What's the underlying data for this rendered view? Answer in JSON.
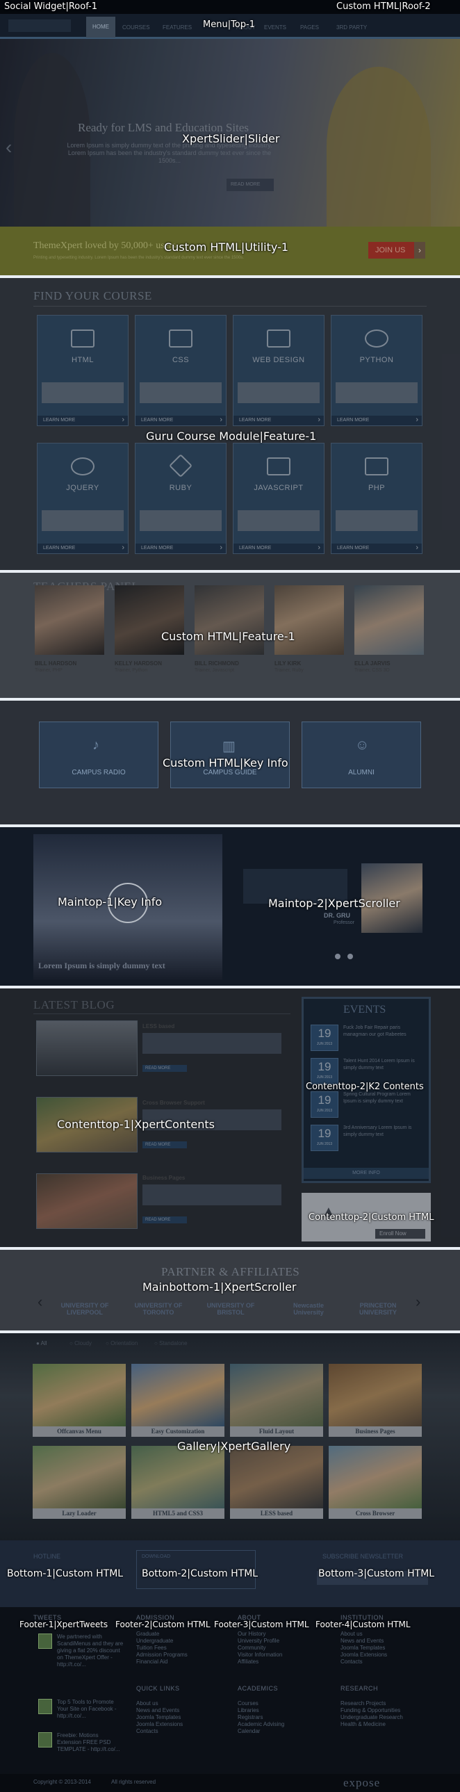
{
  "overlay_labels": {
    "roof1": "Social Widget|Roof-1",
    "roof2": "Custom HTML|Roof-2",
    "top1": "Menu|Top-1",
    "slider": "XpertSlider|Slider",
    "utility1": "Custom HTML|Utility-1",
    "feature1_course": "Guru Course Module|Feature-1",
    "feature1_teachers": "Custom HTML|Feature-1",
    "keyinfo": "Custom HTML|Key Info",
    "maintop1": "Maintop-1|Key Info",
    "maintop2": "Maintop-2|XpertScroller",
    "contenttop2_k2": "Contenttop-2|K2 Contents",
    "contenttop1": "Contenttop-1|XpertContents",
    "contenttop2_html": "Contenttop-2|Custom HTML",
    "mainbottom1": "Mainbottom-1|XpertScroller",
    "gallery": "Gallery|XpertGallery",
    "bottom1": "Bottom-1|Custom HTML",
    "bottom2": "Bottom-2|Custom HTML",
    "bottom3": "Bottom-3|Custom HTML",
    "footer1": "Footer-1|XpertTweets",
    "footer2": "Footer-2|Custom HTML",
    "footer3": "Footer-3|Custom HTML",
    "footer4": "Footer-4|Custom HTML"
  },
  "menu": {
    "items": [
      "HOME",
      "COURSES",
      "FEATURES",
      "ABOUT",
      "EVENTS",
      "PAGES",
      "3RD PARTY"
    ]
  },
  "slider": {
    "title": "Ready for LMS and Education Sites",
    "text": "Lorem Ipsum is simply dummy text of the printing and typesetting industry. Lorem Ipsum has been the industry's standard dummy text ever since the 1500s...",
    "button": "READ MORE"
  },
  "utility": {
    "text": "ThemeXpert loved by 50,000+ users",
    "sub": "Printing and typesetting industry. Lorem Ipsum has been the industry's standard dummy text ever since the 1500s.",
    "button": "JOIN US"
  },
  "course": {
    "heading": "FIND YOUR COURSE",
    "cards": [
      "HTML",
      "CSS",
      "WEB DESIGN",
      "PYTHON",
      "JQUERY",
      "RUBY",
      "JAVASCRIPT",
      "PHP"
    ],
    "button": "LEARN MORE"
  },
  "teachers": {
    "heading": "TEACHERS PANEL",
    "items": [
      {
        "name": "BILL HARDSON",
        "role": "Trainer, PHP"
      },
      {
        "name": "KELLY HARDSON",
        "role": "Trainer, Python"
      },
      {
        "name": "BILL RICHMOND",
        "role": "Trainer, Javascript"
      },
      {
        "name": "LILY KIRK",
        "role": "Trainer, Ruby"
      },
      {
        "name": "ELLA JARVIS",
        "role": "Trainer, CSS 3D"
      }
    ]
  },
  "keyinfo": {
    "items": [
      "CAMPUS RADIO",
      "CAMPUS GUIDE",
      "ALUMNI"
    ]
  },
  "maintop": {
    "caption": "Lorem Ipsum is simply dummy text",
    "person": "DR. GRU",
    "person_role": "Professor"
  },
  "blog": {
    "heading": "LATEST BLOG",
    "items": [
      {
        "title": "LESS based",
        "button": "READ MORE"
      },
      {
        "title": "Cross Browser Support",
        "button": "READ MORE"
      },
      {
        "title": "Business Pages",
        "button": "READ MORE"
      }
    ]
  },
  "events": {
    "heading": "EVENTS",
    "items": [
      {
        "day": "19",
        "month": "JUN 2013",
        "text": "Fuck Job Fair Repair paris managman our got Rabeetes"
      },
      {
        "day": "19",
        "month": "JUN 2013",
        "text": "Talent Hunt 2014 Lorem Ipsum is simply dummy text"
      },
      {
        "day": "19",
        "month": "JUN 2013",
        "text": "Spring Cultural Program Lorem Ipsum is simply dummy text"
      },
      {
        "day": "19",
        "month": "JUN 2013",
        "text": "3rd Anniversary Lorem Ipsum is simply dummy text"
      }
    ],
    "more": "MORE INFO",
    "enroll": "Enroll Now"
  },
  "partners": {
    "heading": "PARTNER & AFFILIATES",
    "logos": [
      "UNIVERSITY OF LIVERPOOL",
      "UNIVERSITY OF TORONTO",
      "UNIVERSITY OF BRISTOL",
      "Newcastle University",
      "PRINCETON UNIVERSITY"
    ]
  },
  "gallery": {
    "filters": [
      "All",
      "Cloudy",
      "Orientation",
      "Standalone"
    ],
    "items": [
      "Offcanvas Menu",
      "Easy Customization",
      "Fluid Layout",
      "Business Pages",
      "Lazy Loader",
      "HTML5 and CSS3",
      "LESS based",
      "Cross Browser"
    ]
  },
  "bottom": {
    "hotline": "HOTLINE",
    "download": "DOWNLOAD",
    "newsletter": "SUBSCRIBE NEWSLETTER"
  },
  "footer": {
    "tweets_heading": "TWEETS",
    "tweets": [
      "We partnered with ScandiMenus and they are giving a flat 20% discount on ThemeXpert Offer - http://t.co/...",
      "Top 5 Tools to Promote Your Site on Facebook - http://t.co/...",
      "Freebie: Motions Extension FREE PSD TEMPLATE - http://t.co/..."
    ],
    "admission_heading": "ADMISSION",
    "admission": [
      "Graduate",
      "Undergraduate",
      "Tuition Fees",
      "Admission Programs",
      "Financial Aid"
    ],
    "about_heading": "ABOUT",
    "about": [
      "Our History",
      "University Profile",
      "Community",
      "Visitor Information",
      "Affiliates"
    ],
    "institution_heading": "INSTITUTION",
    "institution": [
      "About us",
      "News and Events",
      "Joomla Templates",
      "Joomla Extensions",
      "Contacts"
    ],
    "quicklinks_heading": "QUICK LINKS",
    "quicklinks": [
      "About us",
      "News and Events",
      "Joomla Templates",
      "Joomla Extensions",
      "Contacts"
    ],
    "academics_heading": "ACADEMICS",
    "academics": [
      "Courses",
      "Libraries",
      "Registrars",
      "Academic Advising",
      "Calendar"
    ],
    "research_heading": "RESEARCH",
    "research": [
      "Research Projects",
      "Funding & Opportunities",
      "Undergraduate Research",
      "Health & Medicine"
    ],
    "copyright": "Copyright © 2013-2014",
    "rights": "All rights reserved",
    "brand": "expose"
  }
}
